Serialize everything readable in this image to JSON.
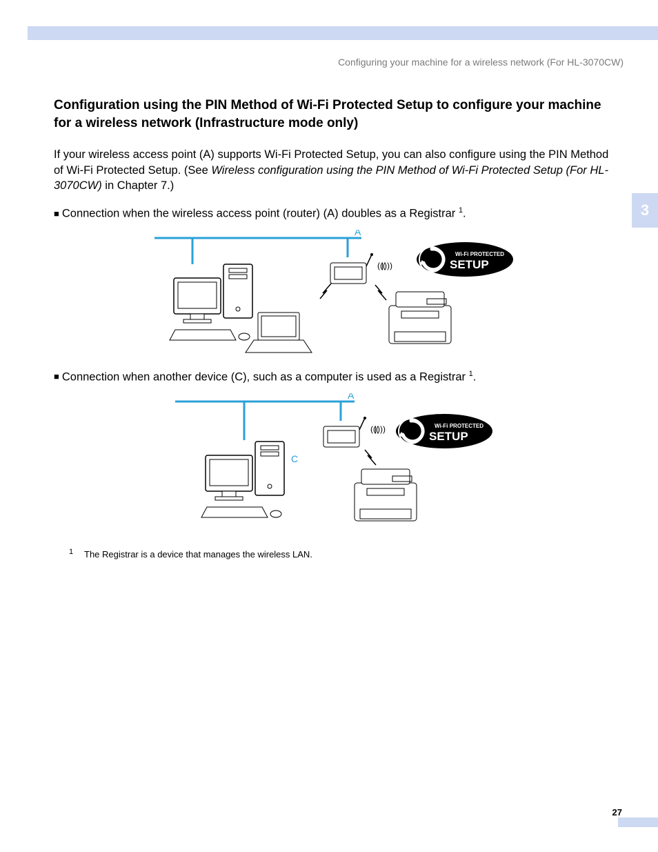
{
  "runningHeader": "Configuring your machine for a wireless network (For HL-3070CW)",
  "chapterTab": "3",
  "pageNumber": "27",
  "sectionTitle": "Configuration using the PIN Method of Wi-Fi Protected Setup to configure your machine for a wireless network (Infrastructure mode only)",
  "intro": {
    "part1": "If your wireless access point (A) supports Wi-Fi Protected Setup, you can also configure using the PIN Method of Wi-Fi Protected Setup. (See ",
    "italic": "Wireless configuration using the PIN Method of Wi-Fi Protected Setup (For HL-3070CW)",
    "part2": " in Chapter 7.)"
  },
  "bullet1": "Connection when the wireless access point (router) (A) doubles as a Registrar ",
  "bullet1SupRef": "1",
  "bullet2": "Connection when another device (C), such as a computer is used as a Registrar ",
  "bullet2SupRef": "1",
  "diagram": {
    "labelA": "A",
    "labelC": "C",
    "wpsTop": "Wi-Fi PROTECTED",
    "wpsBottom": "SETUP"
  },
  "footnote": {
    "num": "1",
    "text": "The Registrar is a device that manages the wireless LAN."
  }
}
